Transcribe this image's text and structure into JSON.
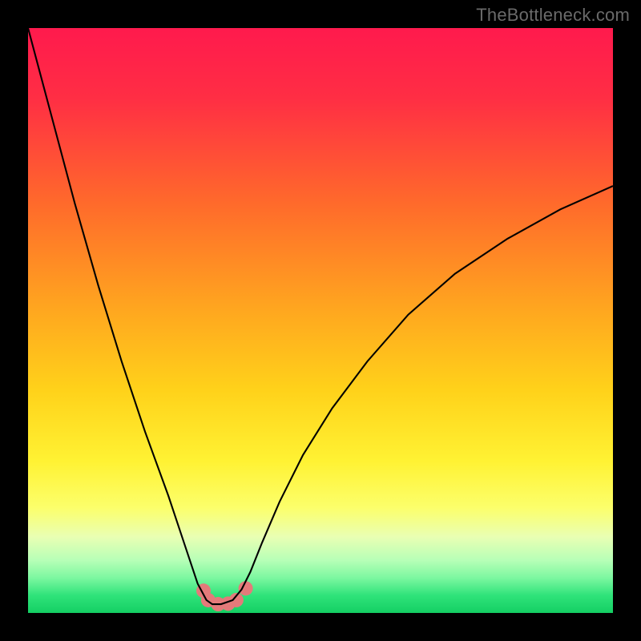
{
  "watermark": "TheBottleneck.com",
  "chart_data": {
    "type": "line",
    "title": "",
    "xlabel": "",
    "ylabel": "",
    "xlim": [
      0,
      100
    ],
    "ylim": [
      0,
      100
    ],
    "background_gradient": {
      "stops": [
        {
          "offset": 0,
          "color": "#ff1a4d"
        },
        {
          "offset": 12,
          "color": "#ff2e44"
        },
        {
          "offset": 30,
          "color": "#ff6a2b"
        },
        {
          "offset": 48,
          "color": "#ffa61f"
        },
        {
          "offset": 62,
          "color": "#ffd21a"
        },
        {
          "offset": 74,
          "color": "#fff233"
        },
        {
          "offset": 82,
          "color": "#fcff6b"
        },
        {
          "offset": 87,
          "color": "#e9ffb3"
        },
        {
          "offset": 91,
          "color": "#b7ffb7"
        },
        {
          "offset": 94,
          "color": "#7cf7a0"
        },
        {
          "offset": 97,
          "color": "#2fe37a"
        },
        {
          "offset": 100,
          "color": "#14cf63"
        }
      ]
    },
    "series": [
      {
        "name": "bottleneck-curve",
        "color": "#000000",
        "width": 2.1,
        "x": [
          0,
          4,
          8,
          12,
          16,
          20,
          24,
          27,
          29,
          30.5,
          31.5,
          33,
          35,
          36.5,
          38,
          40,
          43,
          47,
          52,
          58,
          65,
          73,
          82,
          91,
          100
        ],
        "values": [
          100,
          85,
          70,
          56,
          43,
          31,
          20,
          11,
          5,
          2.2,
          1.5,
          1.5,
          2.2,
          4,
          7,
          12,
          19,
          27,
          35,
          43,
          51,
          58,
          64,
          69,
          73
        ]
      }
    ],
    "markers": {
      "name": "highlight-dots",
      "color": "#e47a7a",
      "radius": 9,
      "points": [
        {
          "x": 30.0,
          "y": 3.8
        },
        {
          "x": 30.8,
          "y": 2.2
        },
        {
          "x": 32.5,
          "y": 1.5
        },
        {
          "x": 34.2,
          "y": 1.6
        },
        {
          "x": 35.6,
          "y": 2.2
        },
        {
          "x": 37.2,
          "y": 4.2
        }
      ]
    }
  }
}
